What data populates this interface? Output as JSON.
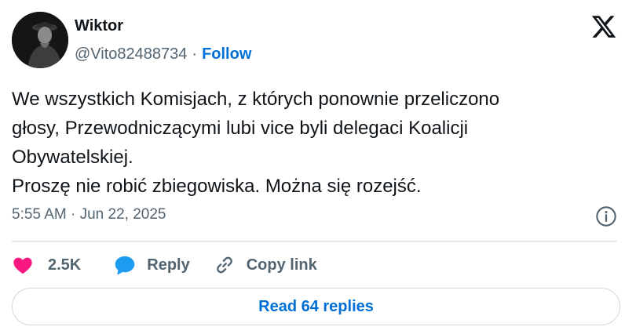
{
  "author": {
    "name": "Wiktor",
    "handle": "@Vito82488734",
    "separator": "·",
    "follow_label": "Follow"
  },
  "tweet": {
    "lines": [
      "We wszystkich Komisjach, z których ponownie przeliczono",
      "głosy, Przewodniczącymi lubi vice byli delegaci Koalicji",
      "Obywatelskiej.",
      "Proszę nie robić zbiegowiska. Można się rozejść."
    ],
    "timestamp": "5:55 AM · Jun 22, 2025"
  },
  "actions": {
    "likes": "2.5K",
    "reply": "Reply",
    "copy_link": "Copy link"
  },
  "read_replies": "Read 64 replies",
  "colors": {
    "accent": "#006fd6",
    "heart": "#f91880",
    "reply_bubble": "#1d9bf0",
    "muted": "#536471",
    "border": "#cfd9de"
  }
}
